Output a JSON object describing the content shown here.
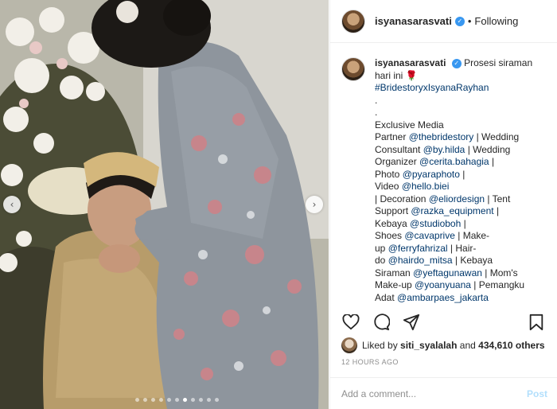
{
  "post": {
    "username": "isyanasarasvati",
    "follow_label": "Following",
    "separator": "•",
    "verified_icon": "verified-badge-icon",
    "caption": {
      "username": "isyanasarasvati",
      "first_line": "Prosesi siraman",
      "second_line": "hari ini",
      "emoji": "🌹",
      "hashtag": "#BridestoryxIsyanaRayhan",
      "dot1": ".",
      "dot2": ".",
      "lines": [
        "Exclusive Media",
        "Partner @thebridestory | Wedding",
        "Consultant @by.hilda | Wedding",
        "Organizer @cerita.bahagia |",
        "Photo @pyaraphoto |",
        "Video @hello.biei",
        "| Decoration @eliordesign | Tent",
        "Support @razka_equipment |",
        "Kebaya @studioboh |",
        "Shoes @cavaprive | Make-",
        "up @ferryfahrizal | Hair-",
        "do @hairdo_mitsa | Kebaya",
        "Siraman @yeftagunawan | Mom's",
        "Make-up @yoanyuana | Pemangku",
        "Adat @ambarpaes_jakarta"
      ]
    },
    "likes": {
      "prefix": "Liked by",
      "user": "siti_syalalah",
      "middle": "and",
      "count": "434,610 others"
    },
    "timestamp": "12 HOURS AGO",
    "comment": {
      "placeholder": "Add a comment...",
      "post_label": "Post"
    },
    "carousel": {
      "prev_label": "‹",
      "next_label": "›",
      "total_slides": 11,
      "active_slide": 7
    }
  },
  "colors": {
    "link": "#00376b",
    "verified": "#3897f0",
    "muted": "#8e8e8e",
    "post_disabled": "#b2dffc"
  }
}
